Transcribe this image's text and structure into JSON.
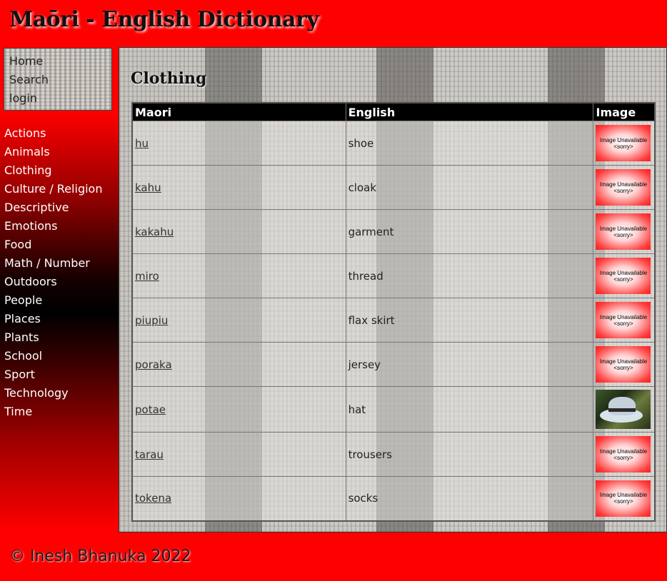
{
  "site": {
    "title": "Maōri - English Dictionary"
  },
  "topnav": {
    "items": [
      "Home",
      "Search",
      "login"
    ]
  },
  "categories": [
    "Actions",
    "Animals",
    "Clothing",
    "Culture / Religion",
    "Descriptive",
    "Emotions",
    "Food",
    "Math / Number",
    "Outdoors",
    "People",
    "Places",
    "Plants",
    "School",
    "Sport",
    "Technology",
    "Time"
  ],
  "main": {
    "heading": "Clothing",
    "columns": [
      "Maori",
      "English",
      "Image"
    ],
    "unavailable_text": "Image Unavailable <sorry>",
    "rows": [
      {
        "maori": "hu",
        "english": "shoe",
        "image": "unavailable"
      },
      {
        "maori": "kahu",
        "english": "cloak",
        "image": "unavailable"
      },
      {
        "maori": "kakahu",
        "english": "garment",
        "image": "unavailable"
      },
      {
        "maori": "miro",
        "english": "thread",
        "image": "unavailable"
      },
      {
        "maori": "piupiu",
        "english": "flax skirt",
        "image": "unavailable"
      },
      {
        "maori": "poraka",
        "english": "jersey",
        "image": "unavailable"
      },
      {
        "maori": "potae",
        "english": "hat",
        "image": "hat-photo"
      },
      {
        "maori": "tarau",
        "english": "trousers",
        "image": "unavailable"
      },
      {
        "maori": "tokena",
        "english": "socks",
        "image": "unavailable"
      }
    ]
  },
  "footer": {
    "text": "© Inesh Bhanuka 2022"
  },
  "colors": {
    "background": "#ff0000",
    "header_row": "#000000"
  }
}
